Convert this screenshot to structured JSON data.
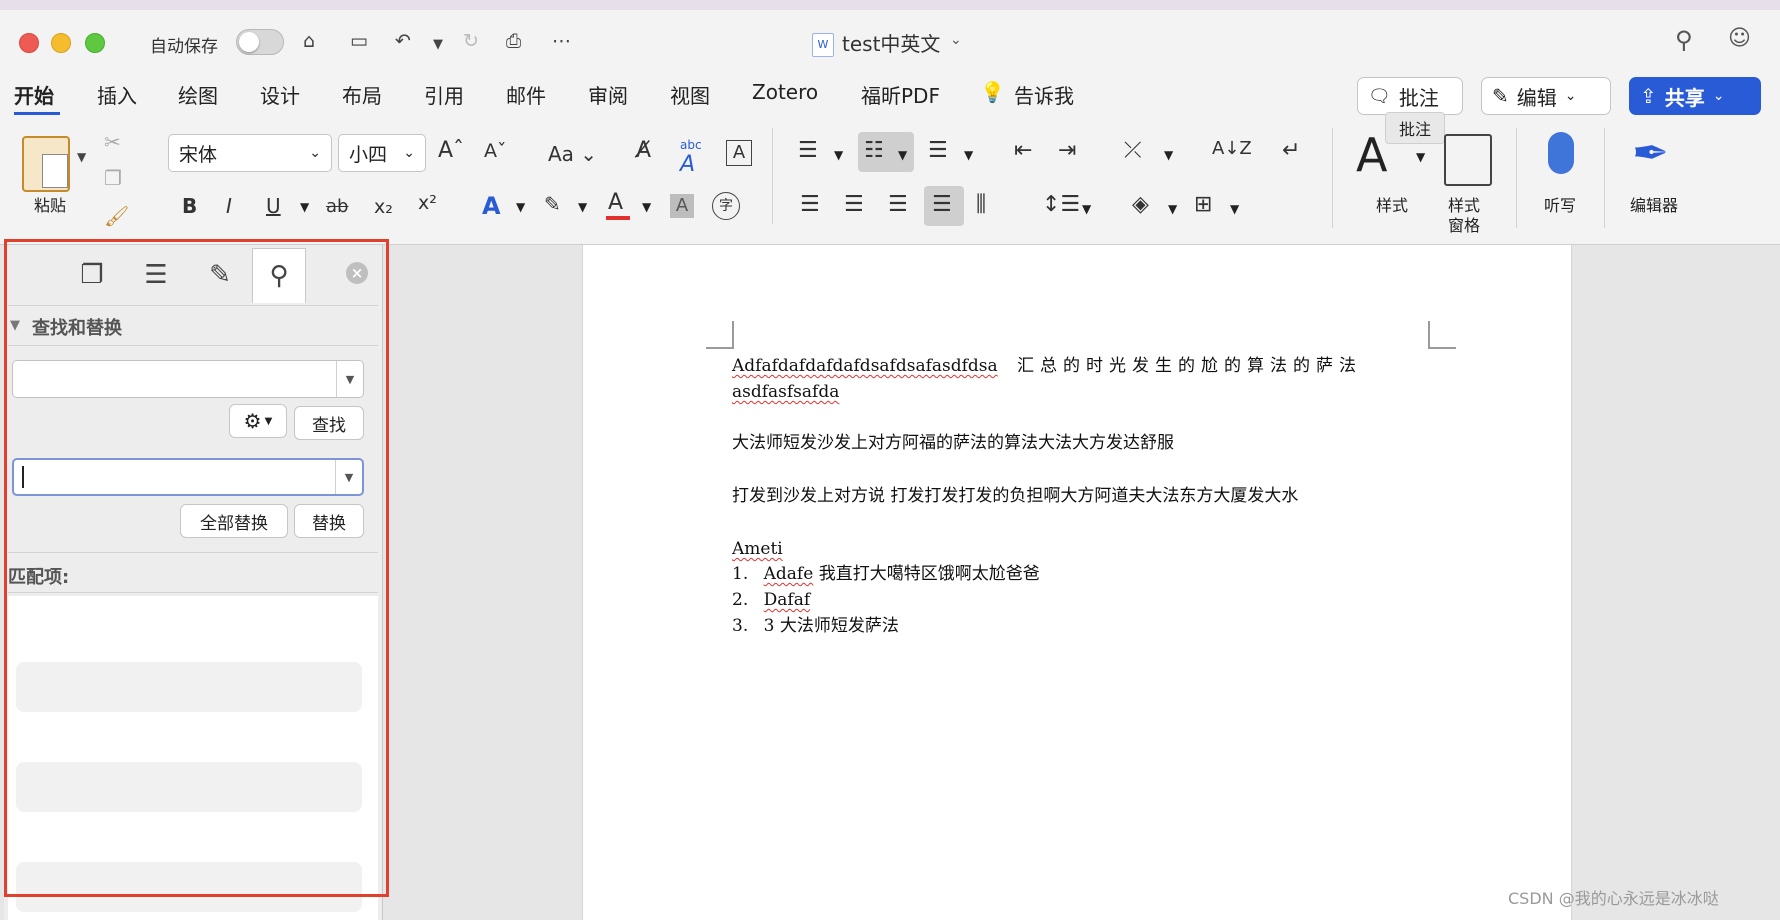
{
  "window": {
    "title": "test中英文",
    "autosave_label": "自动保存",
    "title_icon": "word-doc-icon"
  },
  "tabs": [
    {
      "label": "开始",
      "active": true
    },
    {
      "label": "插入"
    },
    {
      "label": "绘图"
    },
    {
      "label": "设计"
    },
    {
      "label": "布局"
    },
    {
      "label": "引用"
    },
    {
      "label": "邮件"
    },
    {
      "label": "审阅"
    },
    {
      "label": "视图"
    },
    {
      "label": "Zotero"
    },
    {
      "label": "福昕PDF"
    },
    {
      "label": "告诉我"
    }
  ],
  "header_buttons": {
    "comment": "批注",
    "edit": "编辑",
    "share": "共享",
    "tooltip": "批注"
  },
  "ribbon": {
    "paste_label": "粘贴",
    "font_name": "宋体",
    "font_size": "小四",
    "styles_label": "样式",
    "styles_pane_label_1": "样式",
    "styles_pane_label_2": "窗格",
    "dictate_label": "听写",
    "editor_label": "编辑器"
  },
  "find_pane": {
    "section_title": "查找和替换",
    "find_value": "",
    "replace_value": "",
    "find_button": "查找",
    "replace_all_button": "全部替换",
    "replace_button": "替换",
    "matches_label": "匹配项:"
  },
  "document": {
    "line1a": "Adfafdafdafdafdsafdsafasdfdsa",
    "line1b": "汇总的时光发生的尬的算法的萨法",
    "line1c": "asdfasfsafda",
    "para2": "大法师短发沙发上对方阿福的萨法的算法大法大方发达舒服",
    "para3": "打发到沙发上对方说 打发打发打发的负担啊大方阿道夫大法东方大厦发大水",
    "para4": "Ameti",
    "list": [
      {
        "num": "1.",
        "word": "Adafe",
        "rest": "我直打大噶特区饿啊太尬爸爸"
      },
      {
        "num": "2.",
        "word": "Dafaf",
        "rest": ""
      },
      {
        "num": "3.",
        "word": "3",
        "rest": "大法师短发萨法"
      }
    ]
  },
  "watermark": "CSDN @我的心永远是冰冰哒",
  "colors": {
    "accent": "#2a5bd7",
    "highlight_outline": "#e2402f",
    "font_color_bar": "#e03030"
  }
}
